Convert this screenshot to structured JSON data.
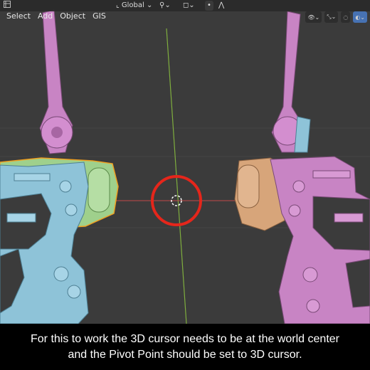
{
  "header": {
    "orientation": "Global",
    "corner_icon": "editor-type-icon",
    "transform_icon": "transform-orientation-icon",
    "snap_icon": "snap-icon",
    "proportional_icon": "proportional-editing-icon"
  },
  "menu": {
    "items": [
      "Select",
      "Add",
      "Object",
      "GIS"
    ]
  },
  "gizmos": {
    "items": [
      "view-object-types-icon",
      "gizmo-icon",
      "overlays-icon",
      "shading-icon"
    ]
  },
  "cursor": {
    "label": "3d-cursor",
    "ring_color": "#e5261b"
  },
  "colors": {
    "viewport_bg": "#3b3b3b",
    "y_axis": "#7fae3e",
    "x_axis": "#c24848",
    "purple_part": "#c884c4",
    "blue_part": "#8ec3d8",
    "green_part": "#9fd08c",
    "orange_part": "#d7a57a",
    "selection_outline": "#f0a020"
  },
  "caption": {
    "line1": "For this to work the 3D cursor needs to be at the world center",
    "line2": "and the Pivot Point should be set to 3D cursor."
  }
}
